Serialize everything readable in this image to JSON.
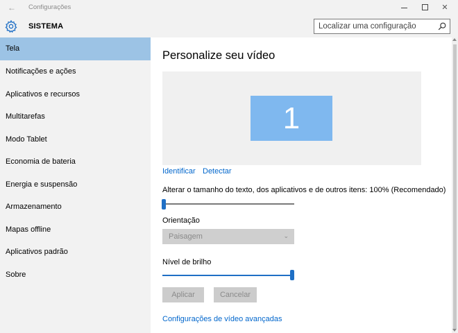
{
  "window": {
    "title": "Configurações",
    "back_icon": "back-arrow-icon",
    "controls": [
      "minimize-icon",
      "maximize-icon",
      "close-icon"
    ]
  },
  "header": {
    "icon": "gear-icon",
    "section_title": "SISTEMA",
    "search_placeholder": "Localizar uma configuração",
    "search_icon": "search-icon"
  },
  "sidebar": {
    "active_index": 0,
    "items": [
      {
        "label": "Tela"
      },
      {
        "label": "Notificações e ações"
      },
      {
        "label": "Aplicativos e recursos"
      },
      {
        "label": "Multitarefas"
      },
      {
        "label": "Modo Tablet"
      },
      {
        "label": "Economia de bateria"
      },
      {
        "label": "Energia e suspensão"
      },
      {
        "label": "Armazenamento"
      },
      {
        "label": "Mapas offline"
      },
      {
        "label": "Aplicativos padrão"
      },
      {
        "label": "Sobre"
      }
    ]
  },
  "main": {
    "title": "Personalize seu vídeo",
    "monitor_number": "1",
    "identify_link": "Identificar",
    "detect_link": "Detectar",
    "text_scale_label": "Alterar o tamanho do texto, dos aplicativos e de outros itens: 100% (Recomendado)",
    "text_scale_value": 0,
    "orientation_label": "Orientação",
    "orientation_value": "Paisagem",
    "brightness_label": "Nível de brilho",
    "brightness_value": 1.0,
    "apply_button": "Aplicar",
    "cancel_button": "Cancelar",
    "advanced_link": "Configurações de vídeo avançadas"
  },
  "colors": {
    "accent": "#1f6fc5",
    "selection": "#9cc3e5",
    "monitor": "#7fb8ef",
    "link": "#0066cc",
    "sidebar_bg": "#f2f2f2"
  }
}
